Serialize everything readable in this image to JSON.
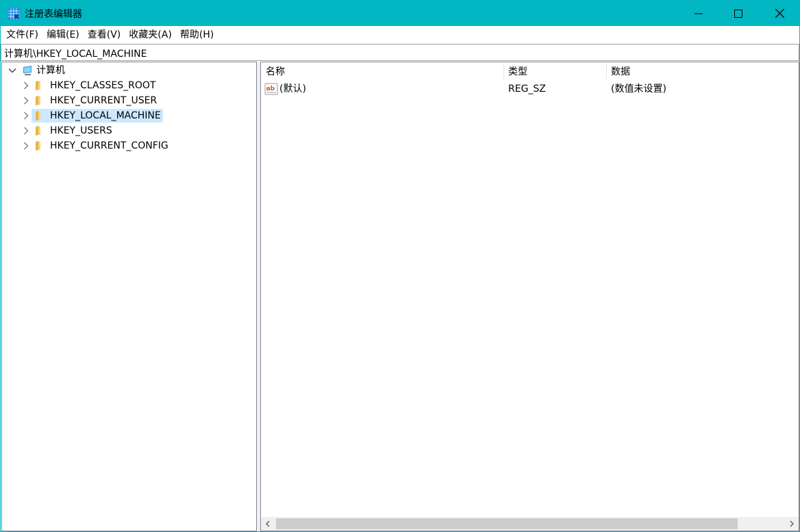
{
  "window": {
    "title": "注册表编辑器",
    "accent_color": "#00b7c3",
    "icons": {
      "app": "registry-grid-icon",
      "minimize": "minimize-icon",
      "maximize": "maximize-icon",
      "close": "close-icon"
    }
  },
  "menubar": {
    "items": [
      "文件(F)",
      "编辑(E)",
      "查看(V)",
      "收藏夹(A)",
      "帮助(H)"
    ]
  },
  "address": {
    "path": "计算机\\HKEY_LOCAL_MACHINE"
  },
  "tree": {
    "root": {
      "label": "计算机",
      "icon": "computer-icon",
      "expanded": true
    },
    "items": [
      {
        "label": "HKEY_CLASSES_ROOT",
        "icon": "folder-icon",
        "selected": false
      },
      {
        "label": "HKEY_CURRENT_USER",
        "icon": "folder-icon",
        "selected": false
      },
      {
        "label": "HKEY_LOCAL_MACHINE",
        "icon": "folder-icon",
        "selected": true
      },
      {
        "label": "HKEY_USERS",
        "icon": "folder-icon",
        "selected": false
      },
      {
        "label": "HKEY_CURRENT_CONFIG",
        "icon": "folder-icon",
        "selected": false
      }
    ],
    "selected_color": "#cce8ff"
  },
  "values": {
    "columns": [
      "名称",
      "类型",
      "数据"
    ],
    "rows": [
      {
        "name": "(默认)",
        "type": "REG_SZ",
        "data": "(数值未设置)",
        "icon": "string-value-icon"
      }
    ]
  }
}
